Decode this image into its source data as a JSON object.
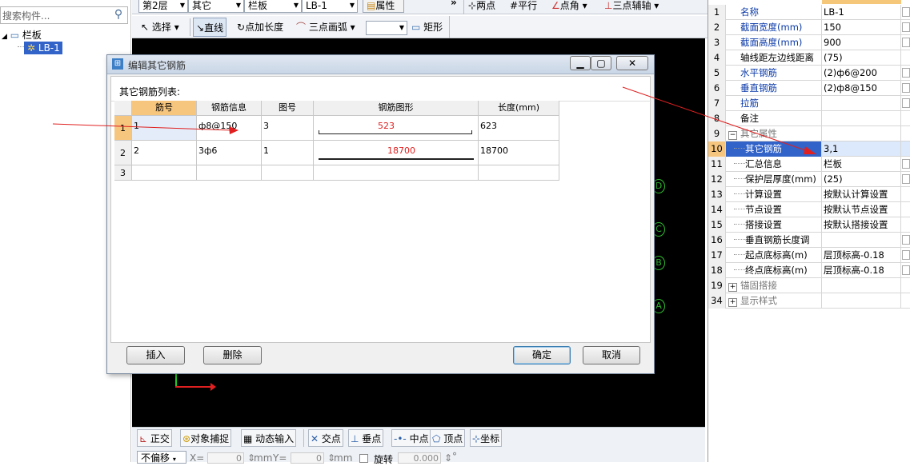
{
  "left_panel": {
    "search_placeholder": "搜索构件...",
    "tree_root": "栏板",
    "tree_child": "LB-1"
  },
  "toolbar1": {
    "floor": "第2层",
    "category": "其它",
    "type": "栏板",
    "component": "LB-1",
    "attr_button": "属性",
    "btn_two_points": "两点",
    "btn_parallel": "平行",
    "btn_point_angle": "点角",
    "btn_three_point_axis": "三点辅轴"
  },
  "toolbar2": {
    "select": "选择",
    "line": "直线",
    "point_length": "点加长度",
    "three_point_arc": "三点画弧",
    "rect": "矩形"
  },
  "canvas": {
    "axis_marks": [
      "D",
      "C",
      "B",
      "A"
    ]
  },
  "dialog": {
    "title": "编辑其它钢筋",
    "list_label": "其它钢筋列表:",
    "columns": [
      "筋号",
      "钢筋信息",
      "图号",
      "钢筋图形",
      "长度(mm)"
    ],
    "rows": [
      {
        "idx": "1",
        "no": "1",
        "info": "ф8@150",
        "fig": "3",
        "shape_value": "523",
        "length": "623"
      },
      {
        "idx": "2",
        "no": "2",
        "info": "3ф6",
        "fig": "1",
        "shape_value": "18700",
        "length": "18700"
      },
      {
        "idx": "3",
        "no": "",
        "info": "",
        "fig": "",
        "shape_value": "",
        "length": ""
      }
    ],
    "btn_insert": "插入",
    "btn_delete": "删除",
    "btn_ok": "确定",
    "btn_cancel": "取消"
  },
  "statusbar": {
    "ortho": "正交",
    "snap": "对象捕捉",
    "dynamic_input": "动态输入",
    "intersection": "交点",
    "perpendicular": "垂点",
    "midpoint": "中点",
    "vertex": "顶点",
    "coordinate": "坐标"
  },
  "coordbar": {
    "mode": "不偏移",
    "x_label": "X=",
    "x_value": "0",
    "unit1": "mm",
    "y_label": "Y=",
    "y_value": "0",
    "unit2": "mm",
    "rotate_label": "旋转",
    "rotate_value": "0.000",
    "deg": "°"
  },
  "properties": [
    {
      "n": "1",
      "name": "名称",
      "value": "LB-1",
      "blue": true
    },
    {
      "n": "2",
      "name": "截面宽度(mm)",
      "value": "150",
      "blue": true
    },
    {
      "n": "3",
      "name": "截面高度(mm)",
      "value": "900",
      "blue": true
    },
    {
      "n": "4",
      "name": "轴线距左边线距离",
      "value": "(75)",
      "blue": false
    },
    {
      "n": "5",
      "name": "水平钢筋",
      "value": "(2)ф6@200",
      "blue": true
    },
    {
      "n": "6",
      "name": "垂直钢筋",
      "value": "(2)ф8@150",
      "blue": true
    },
    {
      "n": "7",
      "name": "拉筋",
      "value": "",
      "blue": true
    },
    {
      "n": "8",
      "name": "备注",
      "value": "",
      "blue": false
    },
    {
      "n": "9",
      "name": "其它属性",
      "value": "",
      "blue": false,
      "group": "−"
    },
    {
      "n": "10",
      "name": "其它钢筋",
      "value": "3,1",
      "blue": false,
      "selected": true
    },
    {
      "n": "11",
      "name": "汇总信息",
      "value": "栏板",
      "blue": false
    },
    {
      "n": "12",
      "name": "保护层厚度(mm)",
      "value": "(25)",
      "blue": false
    },
    {
      "n": "13",
      "name": "计算设置",
      "value": "按默认计算设置",
      "blue": false
    },
    {
      "n": "14",
      "name": "节点设置",
      "value": "按默认节点设置",
      "blue": false
    },
    {
      "n": "15",
      "name": "搭接设置",
      "value": "按默认搭接设置",
      "blue": false
    },
    {
      "n": "16",
      "name": "垂直钢筋长度调",
      "value": "",
      "blue": false
    },
    {
      "n": "17",
      "name": "起点底标高(m)",
      "value": "层顶标高-0.18",
      "blue": false
    },
    {
      "n": "18",
      "name": "终点底标高(m)",
      "value": "层顶标高-0.18",
      "blue": false
    },
    {
      "n": "19",
      "name": "锚固搭接",
      "value": "",
      "blue": false,
      "group": "+"
    },
    {
      "n": "34",
      "name": "显示样式",
      "value": "",
      "blue": false,
      "group": "+"
    }
  ]
}
